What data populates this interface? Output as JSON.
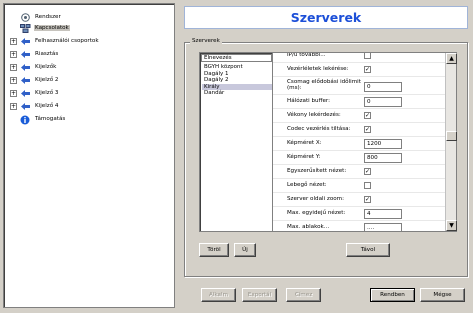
{
  "tree": {
    "items": [
      {
        "label": "Rendszer",
        "icon": "system-icon",
        "expandable": false,
        "selected": false
      },
      {
        "label": "Kapcsolatok",
        "icon": "connections-icon",
        "expandable": false,
        "selected": true
      },
      {
        "label": "Felhasználói csoportok",
        "icon": "arrow-icon",
        "expandable": true,
        "selected": false
      },
      {
        "label": "Riasztás",
        "icon": "arrow-icon",
        "expandable": true,
        "selected": false
      },
      {
        "label": "Kijelzők",
        "icon": "arrow-icon",
        "expandable": true,
        "selected": false
      },
      {
        "label": "Kijelző 2",
        "icon": "arrow-icon",
        "expandable": true,
        "selected": false
      },
      {
        "label": "Kijelző 3",
        "icon": "arrow-icon",
        "expandable": true,
        "selected": false
      },
      {
        "label": "Kijelző 4",
        "icon": "arrow-icon",
        "expandable": true,
        "selected": false
      },
      {
        "label": "Támogatás",
        "icon": "info-icon",
        "expandable": false,
        "selected": false
      }
    ]
  },
  "header": {
    "title": "Szerverek"
  },
  "group": {
    "label": "Szerverek"
  },
  "server_list": {
    "header": "Elnevezés",
    "items": [
      "BGYH központ",
      "Dagály 1",
      "Dagály 2",
      "Király",
      "Dandár"
    ],
    "selected_index": 3
  },
  "properties": {
    "rows": [
      {
        "label": "IP/ű további...",
        "type": "check",
        "checked": false
      },
      {
        "label": "Vezérléletek lekérése:",
        "type": "check",
        "checked": true
      },
      {
        "label": "Csomag elődobási időlimit (ms):",
        "type": "input",
        "value": "0"
      },
      {
        "label": "Hálózati buffer:",
        "type": "input",
        "value": "0"
      },
      {
        "label": "Vékony lekérdezés:",
        "type": "check",
        "checked": true
      },
      {
        "label": "Codec vezérlés tiltása:",
        "type": "check",
        "checked": true
      },
      {
        "label": "Képméret X:",
        "type": "input",
        "value": "1200"
      },
      {
        "label": "Képméret Y:",
        "type": "input",
        "value": "800"
      },
      {
        "label": "Egyszerűsített nézet:",
        "type": "check",
        "checked": true
      },
      {
        "label": "Lebegő nézet:",
        "type": "check",
        "checked": false
      },
      {
        "label": "Szerver oldali zoom:",
        "type": "check",
        "checked": true
      },
      {
        "label": "Max. egyidejű nézet:",
        "type": "input",
        "value": "4"
      },
      {
        "label": "Max. ablakok...",
        "type": "input",
        "value": "...."
      }
    ],
    "scroll_up": "▲",
    "scroll_down": "▼"
  },
  "buttons": {
    "delete": "Töröl",
    "new": "Új",
    "remove": "Távol",
    "apply": "Alkalm",
    "export": "Exportál",
    "import": "Címez",
    "ok": "Rendben",
    "cancel": "Mégse"
  },
  "expander_symbol": "+",
  "check_symbol": "✓"
}
